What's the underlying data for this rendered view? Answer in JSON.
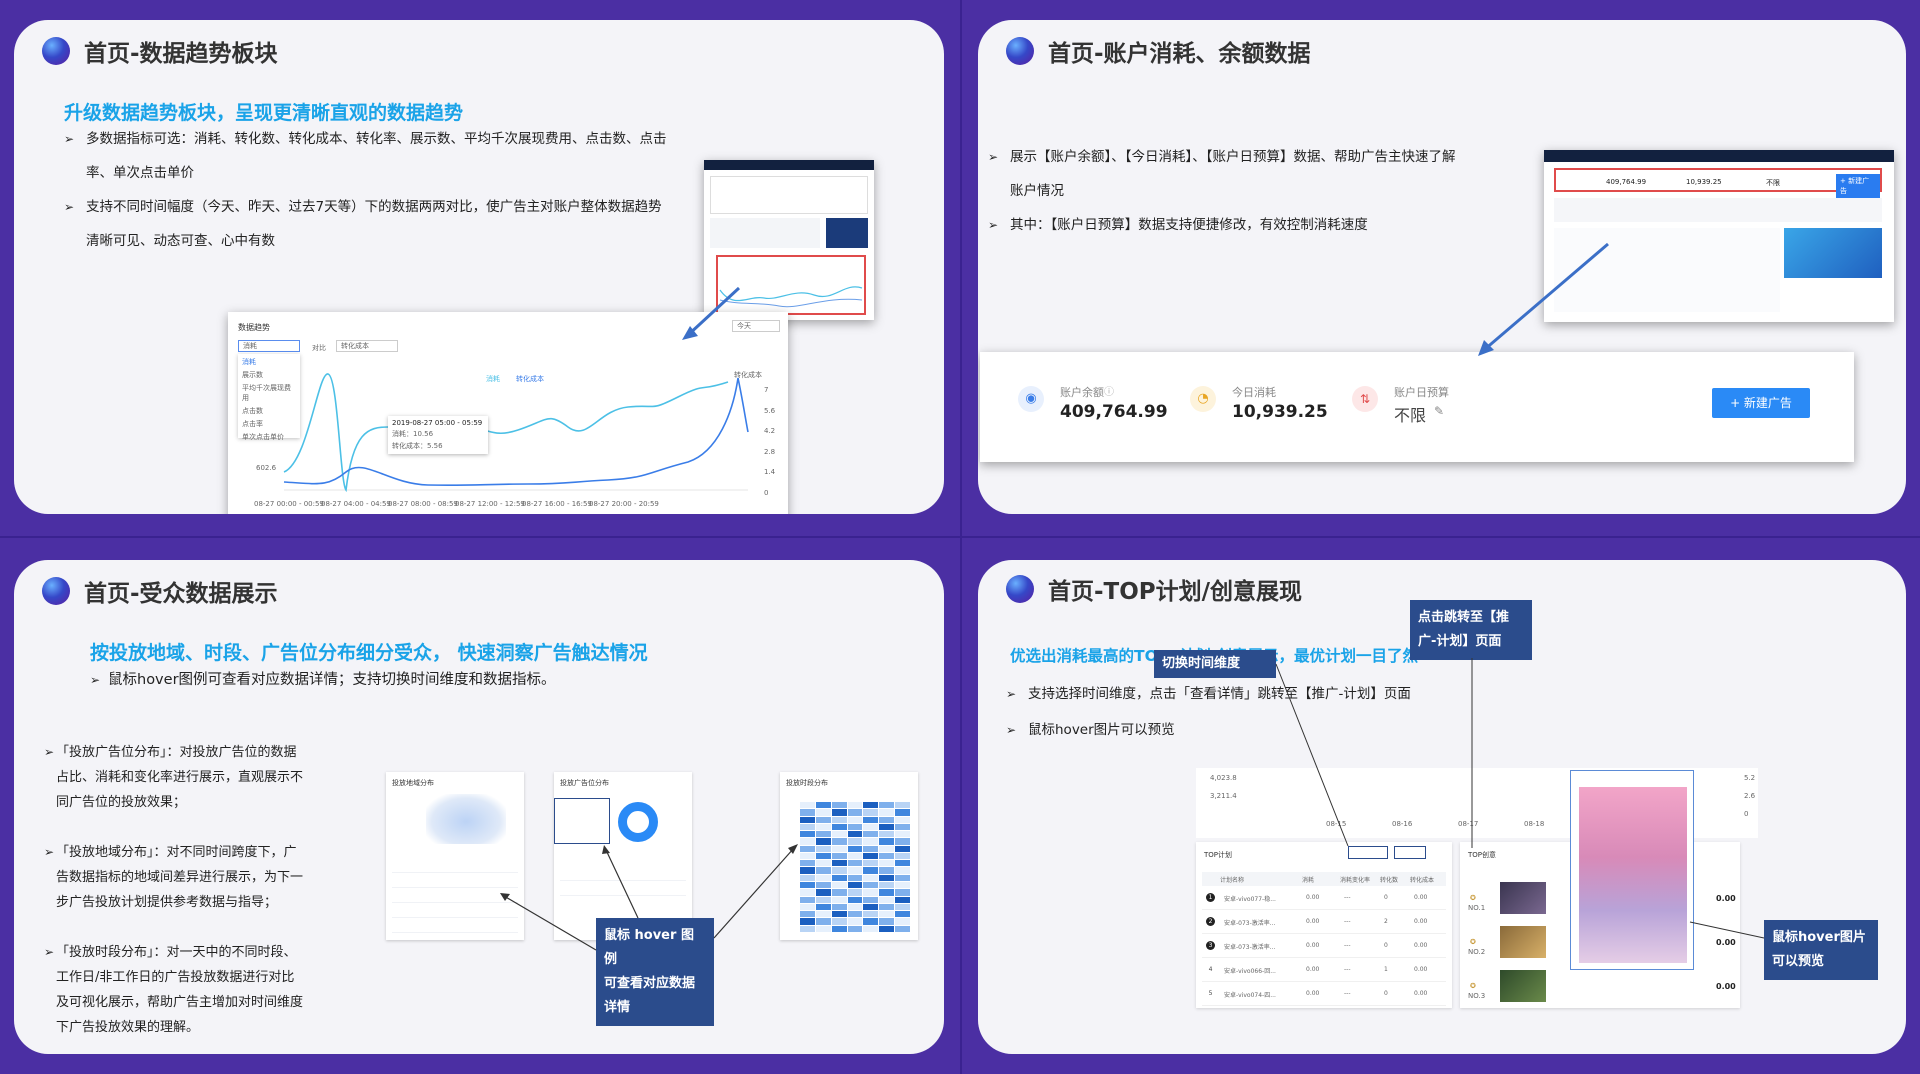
{
  "slides": {
    "trend": {
      "title": "首页-数据趋势板块",
      "subtitle": "升级数据趋势板块，呈现更清晰直观的数据趋势",
      "bullets": [
        "多数据指标可选：消耗、转化数、转化成本、转化率、展示数、平均千次展现费用、点击数、点击",
        "率、单次点击单价",
        "支持不同时间幅度（今天、昨天、过去7天等）下的数据两两对比，使广告主对账户整体数据趋势",
        "清晰可见、动态可查、心中有数"
      ],
      "chart": {
        "title": "数据趋势",
        "metric_select": "消耗",
        "compare_label": "对比",
        "compare_select": "转化成本",
        "range_select": "今天",
        "legend": [
          "消耗",
          "转化成本"
        ],
        "right_axis_label": "转化成本",
        "dropdown_options": [
          "消耗",
          "展示数",
          "平均千次展现费用",
          "点击数",
          "点击率",
          "单次点击单价"
        ],
        "tooltip": {
          "time": "2019-08-27 05:00 - 05:59",
          "row1": "消耗：10.56",
          "row2": "转化成本：5.56"
        },
        "left_ticks": [
          "602.6"
        ],
        "right_ticks": [
          "7",
          "5.6",
          "4.2",
          "2.8",
          "1.4",
          "0"
        ],
        "x_ticks": [
          "08-27 00:00 - 00:59",
          "08-27 04:00 - 04:59",
          "08-27 08:00 - 08:59",
          "08-27 12:00 - 12:59",
          "08-27 16:00 - 16:59",
          "08-27 20:00 - 20:59"
        ]
      }
    },
    "account": {
      "title": "首页-账户消耗、余额数据",
      "bullets": [
        "展示【账户余额】、【今日消耗】、【账户日预算】数据、帮助广告主快速了解",
        "账户情况",
        "其中：【账户日预算】数据支持便捷修改，有效控制消耗速度"
      ],
      "balance_label": "账户余额",
      "balance_value": "409,764.99",
      "spend_label": "今日消耗",
      "spend_value": "10,939.25",
      "budget_label": "账户日预算",
      "budget_value": "不限",
      "new_ad_button": "+ 新建广告",
      "mini": {
        "balance": "409,764.99",
        "spend": "10,939.25",
        "budget": "不限",
        "button": "+ 新建广告"
      }
    },
    "audience": {
      "title": "首页-受众数据展示",
      "subtitle": "按投放地域、时段、广告位分布细分受众， 快速洞察广告触达情况",
      "note": "鼠标hover图例可查看对应数据详情；支持切换时间维度和数据指标。",
      "items": [
        {
          "head": "「投放广告位分布」：对投放广告位的数据",
          "lines": [
            "占比、消耗和变化率进行展示，直观展示不",
            "同广告位的投放效果；"
          ]
        },
        {
          "head": "「投放地域分布」：对不同时间跨度下，广",
          "lines": [
            "告数据指标的地域间差异进行展示，为下一",
            "步广告投放计划提供参考数据与指导；"
          ]
        },
        {
          "head": "「投放时段分布」：对一天中的不同时段、",
          "lines": [
            "工作日/非工作日的广告投放数据进行对比",
            "及可视化展示，帮助广告主增加对时间维度",
            "下广告投放效果的理解。"
          ]
        }
      ],
      "panel_titles": [
        "投放地域分布",
        "投放广告位分布",
        "投放时段分布"
      ],
      "callout": [
        "鼠标 hover 图例",
        "可查看对应数据",
        "详情"
      ]
    },
    "top": {
      "title": "首页-TOP计划/创意展现",
      "subtitle": "优选出消耗最高的TOP5计划/创意展示，最优计划一目了然",
      "bullets": [
        "支持选择时间维度，点击「查看详情」跳转至【推广-计划】页面",
        "鼠标hover图片可以预览"
      ],
      "callout_time": "切换时间维度",
      "callout_jump": [
        "点击跳转至【推",
        "广-计划】页面"
      ],
      "callout_preview": [
        "鼠标hover图片",
        "可以预览"
      ],
      "top_plan_title": "TOP计划",
      "top_creative_title": "TOP创意",
      "headers": [
        "计划名称",
        "消耗",
        "消耗变化率",
        "转化数",
        "转化成本"
      ],
      "rows": [
        [
          "1",
          "安卓-vivo077-稳...",
          "0.00",
          "---",
          "0",
          "0.00"
        ],
        [
          "2",
          "安卓-073-激活率...",
          "0.00",
          "---",
          "2",
          "0.00"
        ],
        [
          "3",
          "安卓-073-激活率...",
          "0.00",
          "---",
          "0",
          "0.00"
        ],
        [
          "4",
          "安卓-vivo066-回...",
          "0.00",
          "---",
          "1",
          "0.00"
        ],
        [
          "5",
          "安卓-vivo074-四...",
          "0.00",
          "---",
          "0",
          "0.00"
        ]
      ],
      "creative_ranks": [
        "NO.1",
        "NO.2",
        "NO.3"
      ],
      "creative_values": [
        "0.00",
        "0.00",
        "0.00"
      ],
      "axis_vals": [
        "4,023.8",
        "3,211.4"
      ],
      "date_ticks": [
        "08-15",
        "08-16",
        "08-17",
        "08-18"
      ],
      "right_vals": [
        "5.2",
        "2.6",
        "0"
      ]
    }
  }
}
